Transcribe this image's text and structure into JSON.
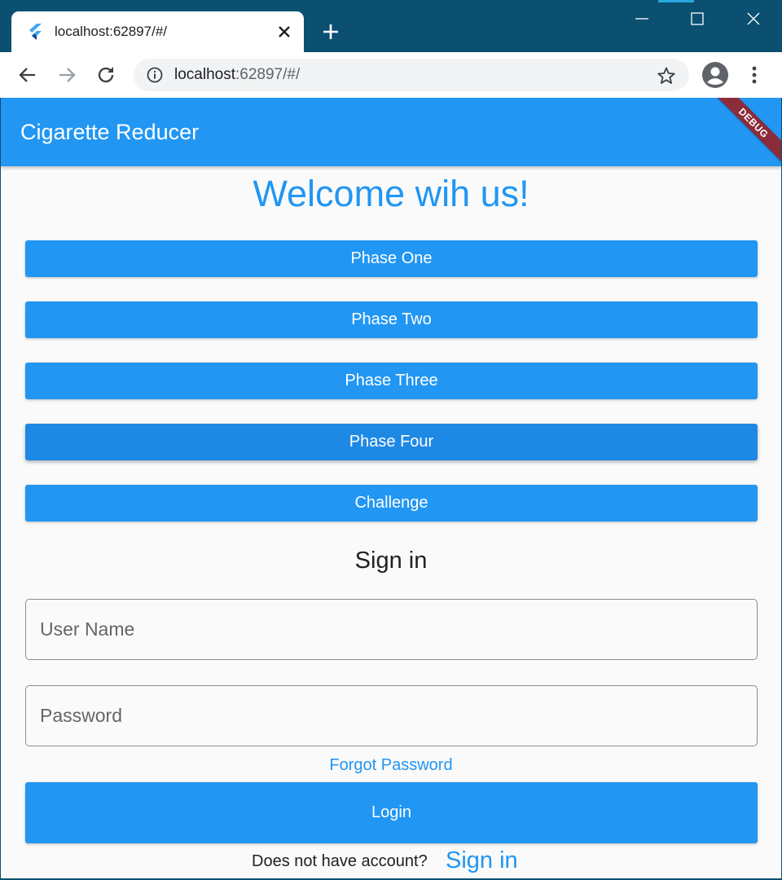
{
  "browser": {
    "tab_title": "localhost:62897/#/",
    "url_host": "localhost",
    "url_rest": ":62897/#/",
    "new_tab_label": "+"
  },
  "app": {
    "title": "Cigarette Reducer",
    "debug_label": "DEBUG",
    "welcome": "Welcome wih us!",
    "phases": [
      {
        "label": "Phase One"
      },
      {
        "label": "Phase Two"
      },
      {
        "label": "Phase Three"
      },
      {
        "label": "Phase Four"
      },
      {
        "label": "Challenge"
      }
    ],
    "signin_heading": "Sign in",
    "username_placeholder": "User Name",
    "password_placeholder": "Password",
    "forgot_password": "Forgot Password",
    "login_label": "Login",
    "no_account_text": "Does not have account?",
    "signin_link": "Sign in"
  },
  "colors": {
    "primary": "#2196f3",
    "window_frame": "#0b4f71",
    "debug_banner": "#8a2c3a"
  },
  "icons": [
    "flutter-icon",
    "close-icon",
    "plus-icon",
    "minimize-icon",
    "maximize-icon",
    "window-close-icon",
    "back-arrow-icon",
    "forward-arrow-icon",
    "reload-icon",
    "info-icon",
    "star-icon",
    "profile-icon",
    "more-vert-icon"
  ]
}
